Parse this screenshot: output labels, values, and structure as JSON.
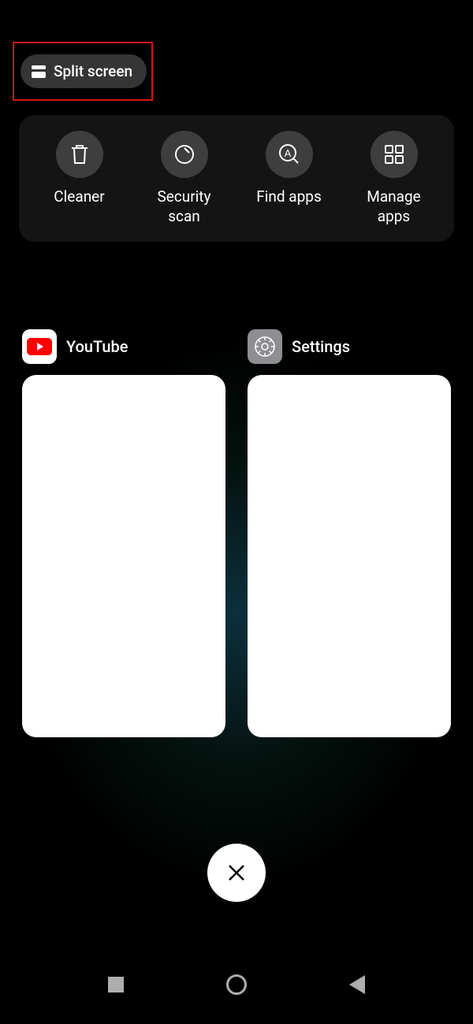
{
  "split_screen": {
    "label": "Split screen"
  },
  "tools": [
    {
      "id": "cleaner",
      "label": "Cleaner",
      "icon": "trash-icon"
    },
    {
      "id": "security",
      "label": "Security\nscan",
      "icon": "scan-icon"
    },
    {
      "id": "find",
      "label": "Find apps",
      "icon": "find-icon"
    },
    {
      "id": "manage",
      "label": "Manage\napps",
      "icon": "grid-icon"
    }
  ],
  "recents": [
    {
      "id": "youtube",
      "name": "YouTube",
      "icon": "youtube-icon"
    },
    {
      "id": "settings",
      "name": "Settings",
      "icon": "settings-icon"
    }
  ],
  "colors": {
    "highlight": "#d01818",
    "youtube_red": "#ff0000"
  }
}
